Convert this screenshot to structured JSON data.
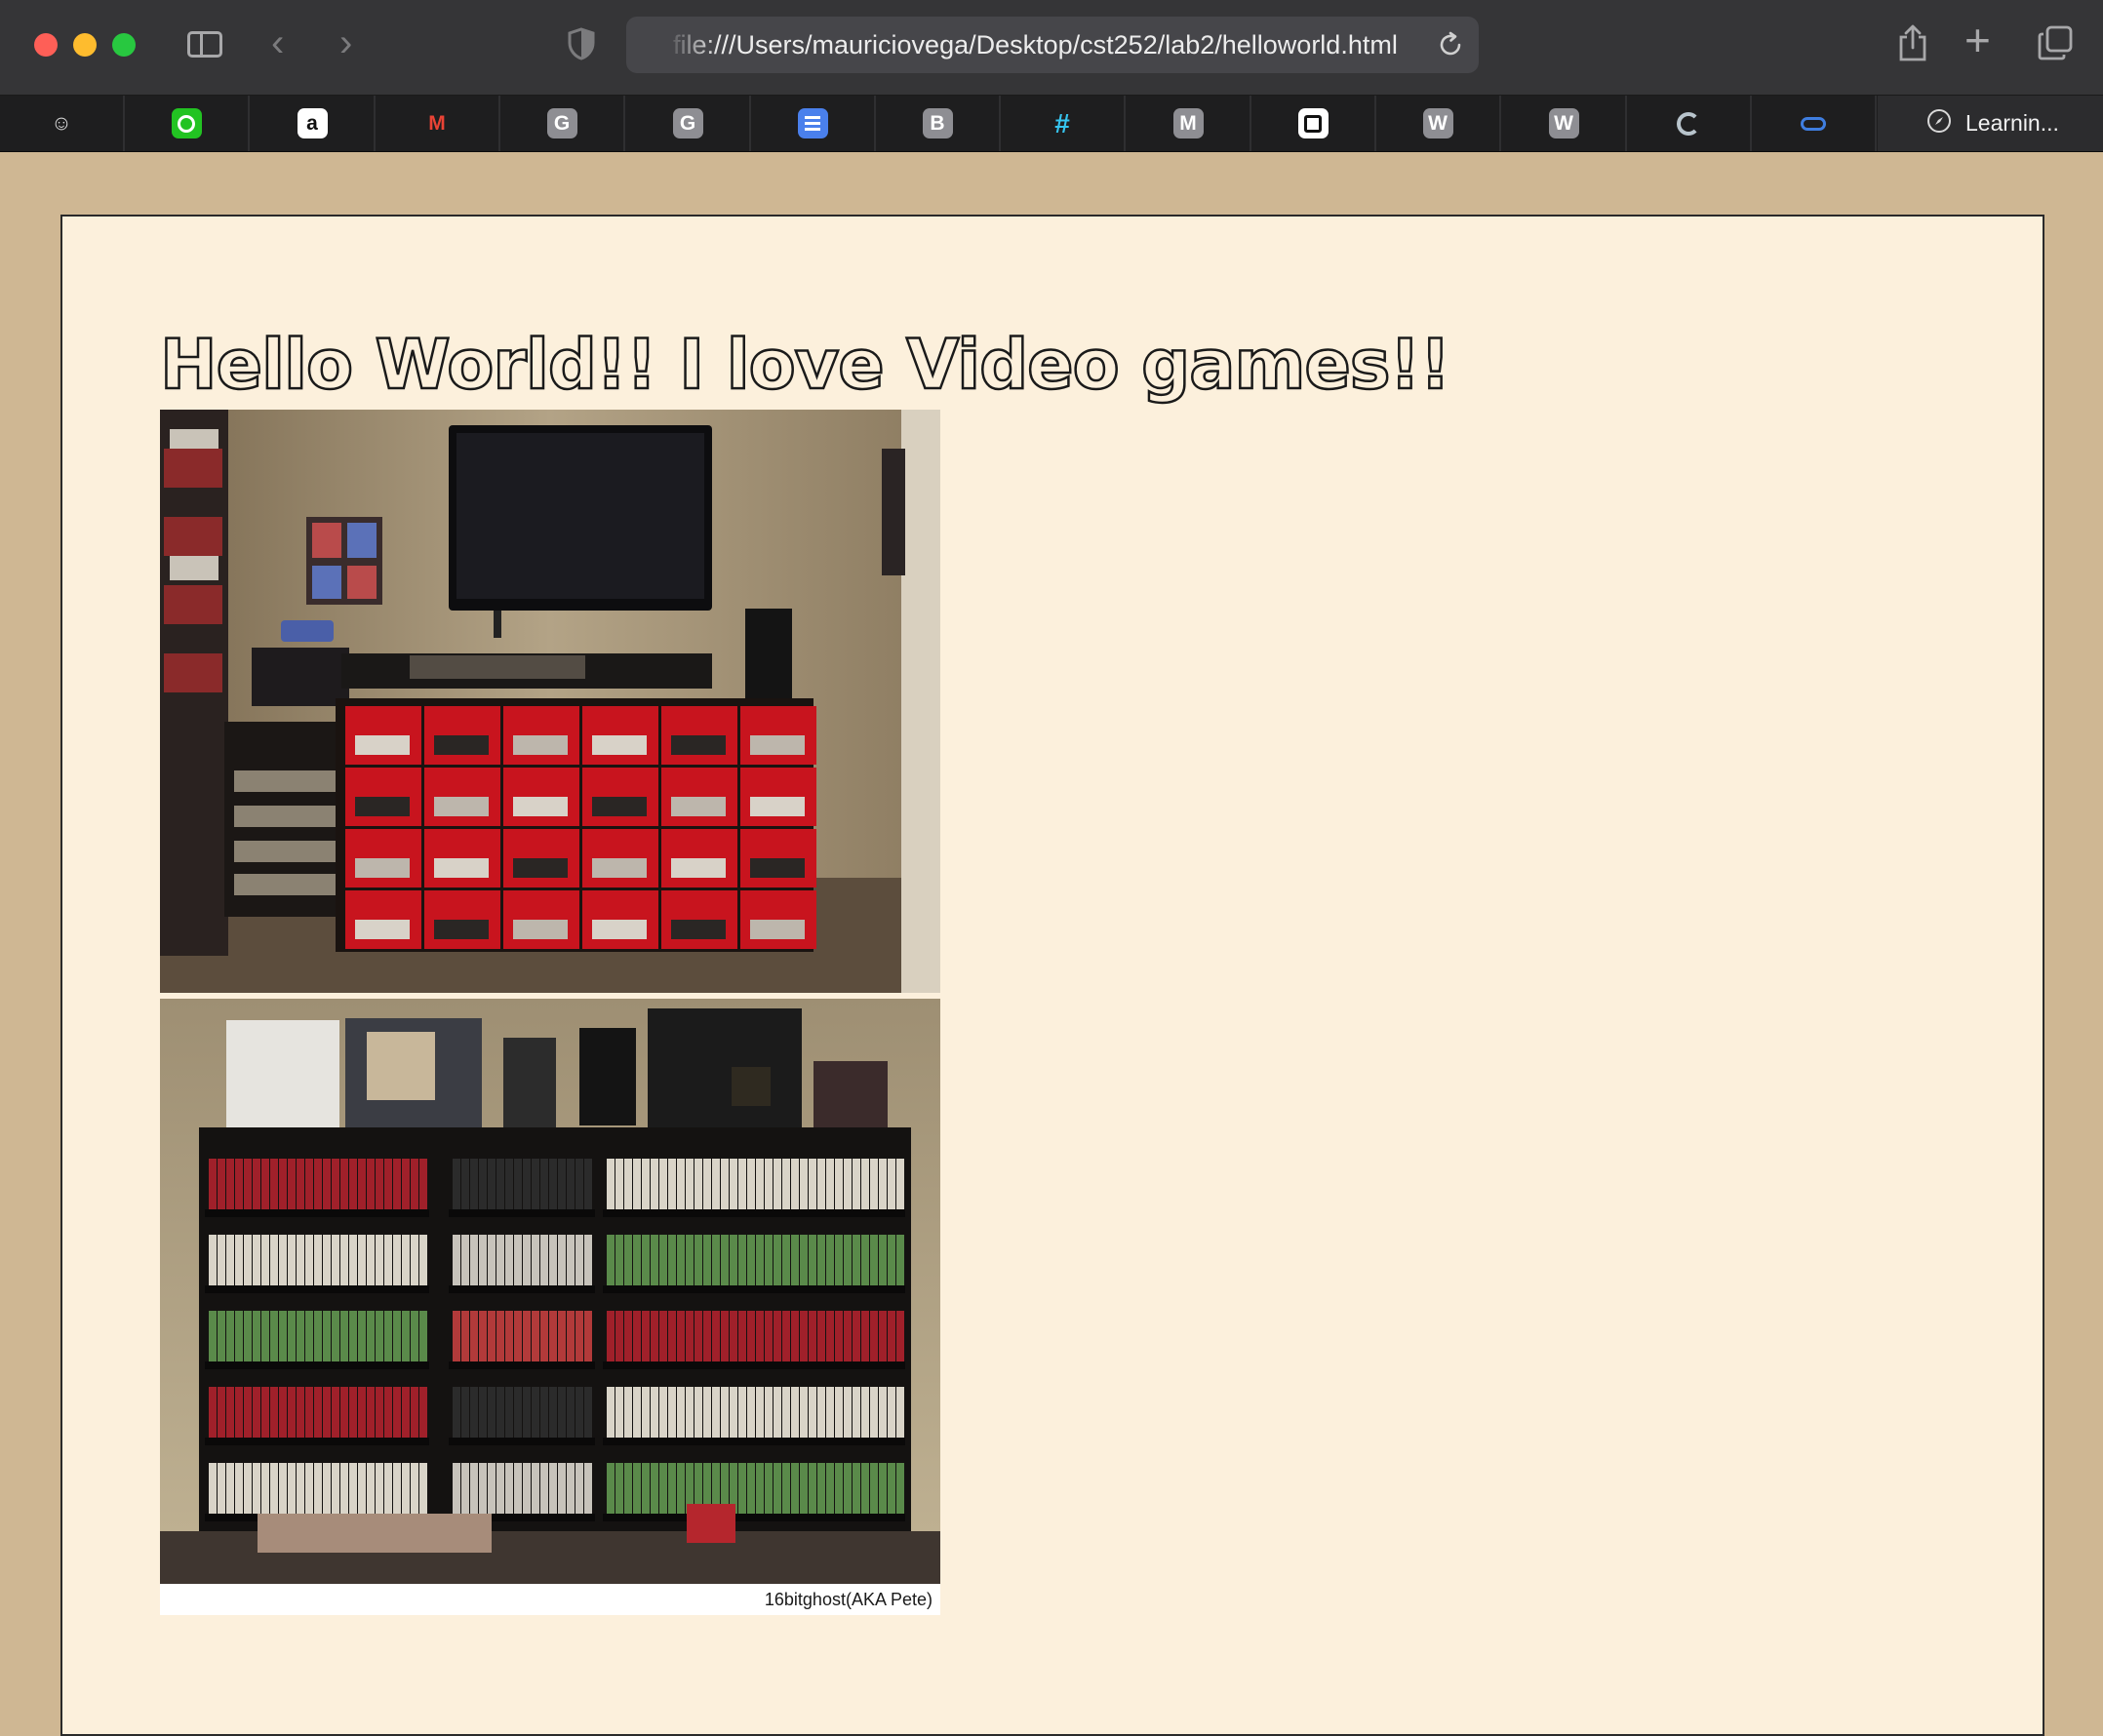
{
  "browser": {
    "url": "file:///Users/mauriciovega/Desktop/cst252/lab2/helloworld.html"
  },
  "favorites": [
    {
      "icon": "ghost-icon",
      "letter": "",
      "bg": "#1e1e1f"
    },
    {
      "icon": "clock-icon",
      "letter": "",
      "bg": "#22c322"
    },
    {
      "icon": "a-icon",
      "letter": "a",
      "bg": "#ffffff"
    },
    {
      "icon": "gmail-icon",
      "letter": "M",
      "bg": "#1e1e1f"
    },
    {
      "icon": "g-icon",
      "letter": "G",
      "bg": "#8e8e93"
    },
    {
      "icon": "g-icon",
      "letter": "G",
      "bg": "#8e8e93"
    },
    {
      "icon": "docs-icon",
      "letter": "",
      "bg": "#4a80ec"
    },
    {
      "icon": "b-icon",
      "letter": "B",
      "bg": "#8e8e93"
    },
    {
      "icon": "slack-icon",
      "letter": "",
      "bg": "#1e1e1f"
    },
    {
      "icon": "m-icon",
      "letter": "M",
      "bg": "#8e8e93"
    },
    {
      "icon": "mail-icon",
      "letter": "",
      "bg": "#ffffff"
    },
    {
      "icon": "w-icon",
      "letter": "W",
      "bg": "#8e8e93"
    },
    {
      "icon": "w-icon",
      "letter": "W",
      "bg": "#8e8e93"
    },
    {
      "icon": "swirl-icon",
      "letter": "",
      "bg": "#1e1e1f"
    },
    {
      "icon": "cloud-icon",
      "letter": "",
      "bg": "#1e1e1f"
    }
  ],
  "learning_tab": {
    "label": "Learnin..."
  },
  "page": {
    "heading": "Hello World!! I love Video games!!",
    "photo_credit": "16bitghost(AKA Pete)"
  }
}
